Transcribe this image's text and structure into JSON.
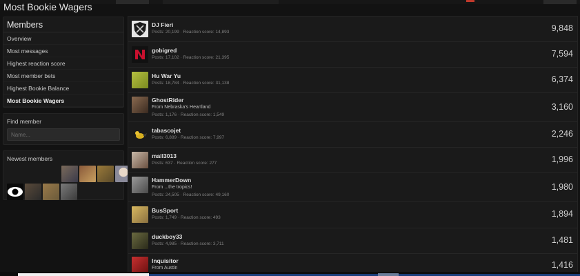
{
  "page": {
    "title": "Most Bookie Wagers"
  },
  "sidebar": {
    "members_heading": "Members",
    "items": [
      {
        "label": "Overview"
      },
      {
        "label": "Most messages"
      },
      {
        "label": "Highest reaction score"
      },
      {
        "label": "Most member bets"
      },
      {
        "label": "Highest Bookie Balance"
      },
      {
        "label": "Most Bookie Wagers",
        "active": true
      }
    ],
    "find_label": "Find member",
    "find_placeholder": "Name...",
    "newest_label": "Newest members"
  },
  "members": [
    {
      "name": "DJ Fieri",
      "title": "",
      "stats": "Posts: 20,199 · Reaction score: 14,893",
      "value": "9,848",
      "avatar_color": "#d9d9d9"
    },
    {
      "name": "gobigred",
      "title": "",
      "stats": "Posts: 17,102 · Reaction score: 21,395",
      "value": "7,594",
      "avatar_color": "#b3001b"
    },
    {
      "name": "Hu War Yu",
      "title": "",
      "stats": "Posts: 18,784 · Reaction score: 31,138",
      "value": "6,374",
      "avatar_color": "#9aa832"
    },
    {
      "name": "GhostRider",
      "title": "From Nebraska's Heartland",
      "stats": "Posts: 1,176 · Reaction score: 1,549",
      "value": "3,160",
      "avatar_color": "#7a5a40"
    },
    {
      "name": "tabascojet",
      "title": "",
      "stats": "Posts: 6,889 · Reaction score: 7,997",
      "value": "2,246",
      "avatar_color": "#c9a51a"
    },
    {
      "name": "mall3013",
      "title": "",
      "stats": "Posts: 637 · Reaction score: 277",
      "value": "1,996",
      "avatar_color": "#a38d78"
    },
    {
      "name": "HammerDown",
      "title": "From ...the tropics!",
      "stats": "Posts: 24,505 · Reaction score: 49,160",
      "value": "1,980",
      "avatar_color": "#6b6b6b"
    },
    {
      "name": "BusSport",
      "title": "",
      "stats": "Posts: 1,749 · Reaction score: 493",
      "value": "1,894",
      "avatar_color": "#c2a24a"
    },
    {
      "name": "duckboy33",
      "title": "",
      "stats": "Posts: 4,985 · Reaction score: 3,711",
      "value": "1,481",
      "avatar_color": "#5a5a3a"
    },
    {
      "name": "Inquisitor",
      "title": "From Austin",
      "stats": "",
      "value": "1,416",
      "avatar_color": "#b8282a"
    }
  ]
}
